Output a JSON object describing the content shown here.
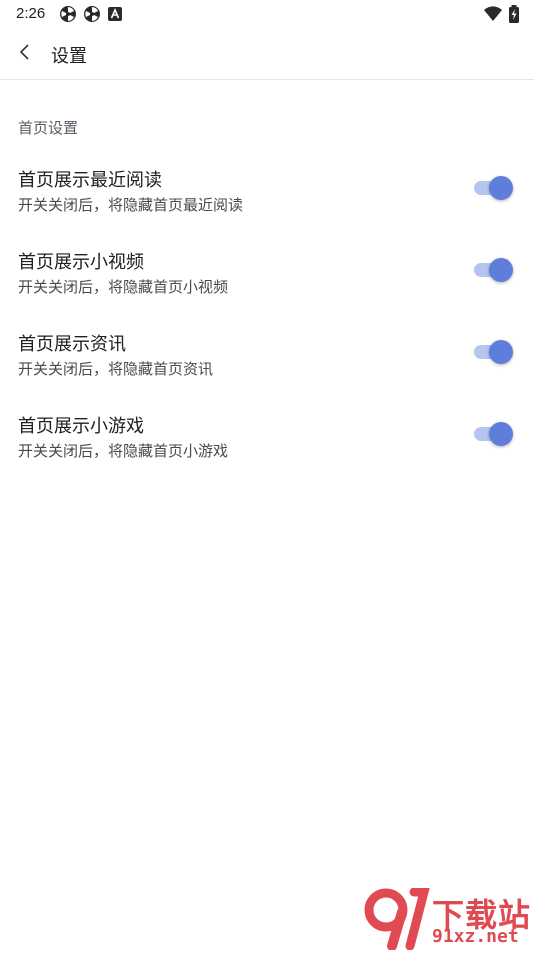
{
  "status_bar": {
    "time": "2:26",
    "left_icons": [
      "pinwheel-icon",
      "pinwheel-icon",
      "font-a-icon"
    ],
    "right_icons": [
      "wifi-icon",
      "battery-charging-icon"
    ]
  },
  "app_bar": {
    "back_icon": "chevron-left-icon",
    "title": "设置"
  },
  "section": {
    "header": "首页设置"
  },
  "settings": [
    {
      "title": "首页展示最近阅读",
      "description": "开关关闭后，将隐藏首页最近阅读",
      "enabled": true
    },
    {
      "title": "首页展示小视频",
      "description": "开关关闭后，将隐藏首页小视频",
      "enabled": true
    },
    {
      "title": "首页展示资讯",
      "description": "开关关闭后，将隐藏首页资讯",
      "enabled": true
    },
    {
      "title": "首页展示小游戏",
      "description": "开关关闭后，将隐藏首页小游戏",
      "enabled": true
    }
  ],
  "colors": {
    "toggle_on_thumb": "#5f7ddb",
    "toggle_on_track": "#b6c5f0",
    "watermark": "#e04a52"
  },
  "watermark": {
    "logo_text": "91",
    "site_name": "下载站",
    "url": "91xz.net"
  }
}
